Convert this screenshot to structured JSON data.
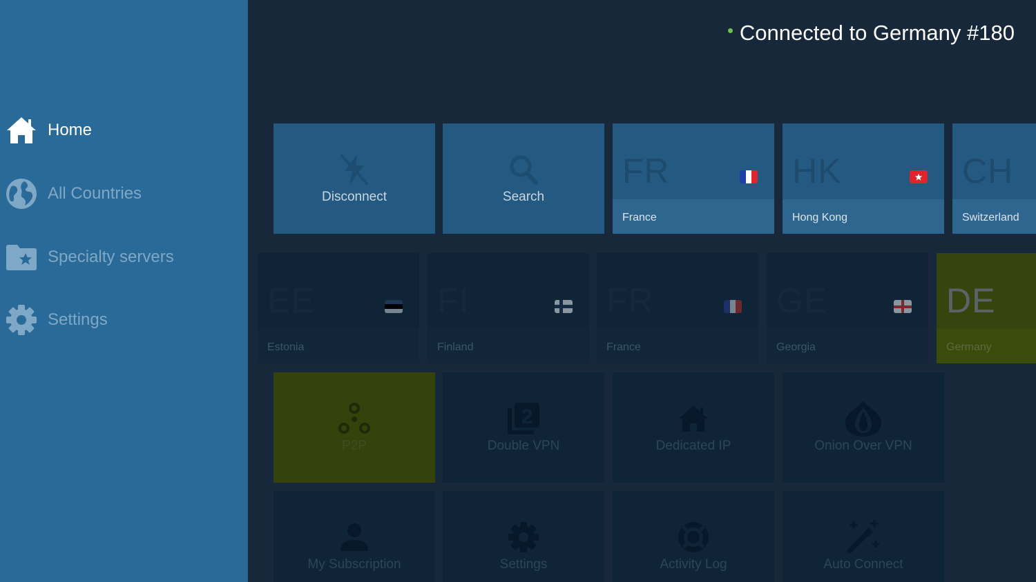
{
  "sidebar": {
    "items": [
      {
        "label": "Home",
        "icon": "home-icon",
        "active": true
      },
      {
        "label": "All Countries",
        "icon": "globe-icon",
        "active": false
      },
      {
        "label": "Specialty servers",
        "icon": "folder-star-icon",
        "active": false
      },
      {
        "label": "Settings",
        "icon": "gear-icon",
        "active": false
      }
    ]
  },
  "status": {
    "text": "Connected to Germany #180",
    "dot_color": "#6cc24a"
  },
  "row1": [
    {
      "label": "Disconnect",
      "icon": "disconnect-icon"
    },
    {
      "label": "Search",
      "icon": "search-icon"
    },
    {
      "code": "FR",
      "name": "France"
    },
    {
      "code": "HK",
      "name": "Hong Kong"
    },
    {
      "code": "CH",
      "name": "Switzerland"
    }
  ],
  "row2": [
    {
      "code": "EE",
      "name": "Estonia"
    },
    {
      "code": "FI",
      "name": "Finland"
    },
    {
      "code": "FR",
      "name": "France"
    },
    {
      "code": "GE",
      "name": "Georgia"
    },
    {
      "code": "DE",
      "name": "Germany"
    }
  ],
  "row3": [
    {
      "label": "P2P",
      "icon": "p2p-icon"
    },
    {
      "label": "Double VPN",
      "icon": "double-vpn-icon"
    },
    {
      "label": "Dedicated IP",
      "icon": "house-icon"
    },
    {
      "label": "Onion Over VPN",
      "icon": "onion-icon"
    }
  ],
  "row4": [
    {
      "label": "My Subscription",
      "icon": "user-icon"
    },
    {
      "label": "Settings",
      "icon": "gear-icon"
    },
    {
      "label": "Activity Log",
      "icon": "lifebuoy-icon"
    },
    {
      "label": "Auto Connect",
      "icon": "magic-wand-icon"
    }
  ],
  "colors": {
    "sidebar": "#2a6a98",
    "background": "#16283a",
    "highlight": "#36450d"
  }
}
